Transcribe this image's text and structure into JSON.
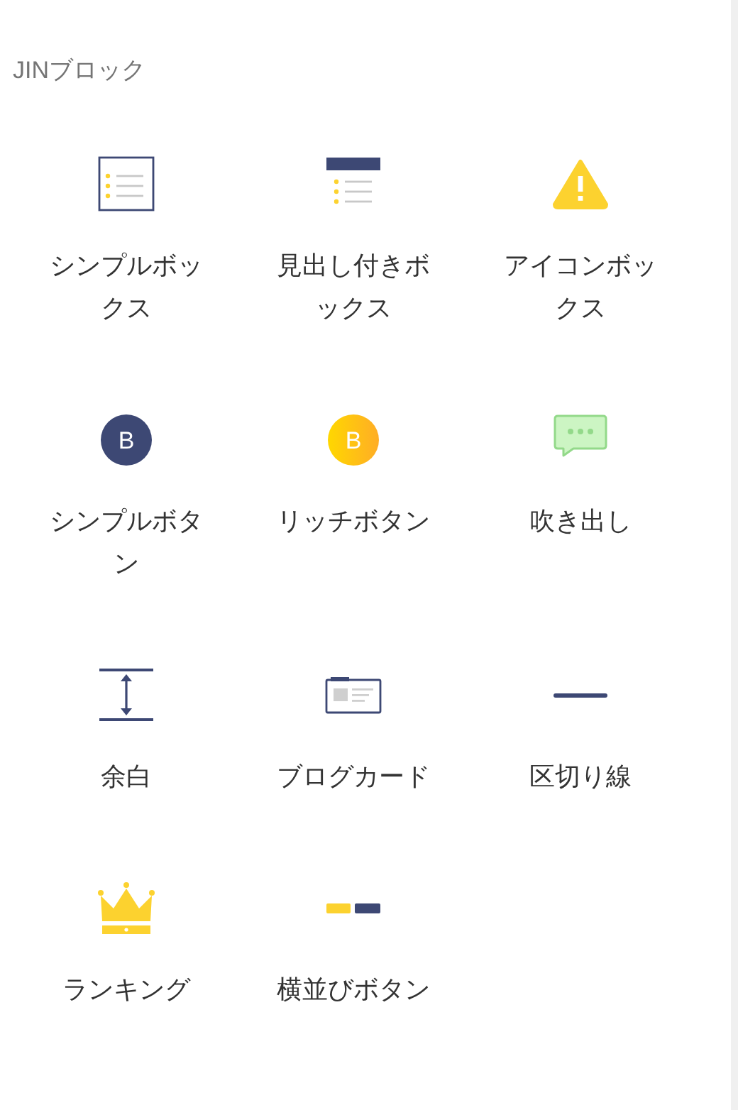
{
  "panel": {
    "title": "JINブロック"
  },
  "blocks": [
    {
      "kind": "simple-box",
      "label": "シンプルボックス"
    },
    {
      "kind": "heading-box",
      "label": "見出し付きボックス"
    },
    {
      "kind": "icon-box",
      "label": "アイコンボックス"
    },
    {
      "kind": "simple-button",
      "label": "シンプルボタン",
      "icon_text": "B"
    },
    {
      "kind": "rich-button",
      "label": "リッチボタン",
      "icon_text": "B"
    },
    {
      "kind": "balloon",
      "label": "吹き出し"
    },
    {
      "kind": "spacer",
      "label": "余白"
    },
    {
      "kind": "blog-card",
      "label": "ブログカード"
    },
    {
      "kind": "separator",
      "label": "区切り線"
    },
    {
      "kind": "ranking",
      "label": "ランキング"
    },
    {
      "kind": "side-buttons",
      "label": "横並びボタン"
    }
  ]
}
